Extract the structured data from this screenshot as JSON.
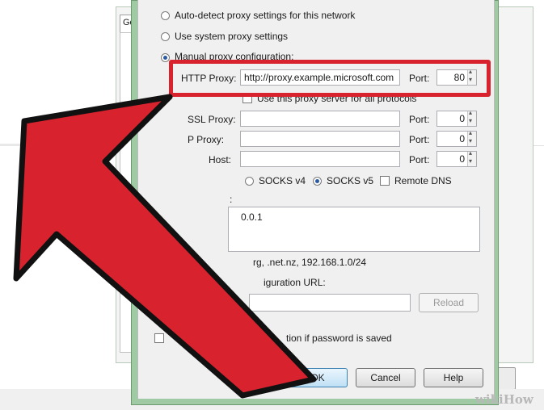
{
  "background": {
    "tab_label": "Ger"
  },
  "proxy": {
    "auto_detect": "Auto-detect proxy settings for this network",
    "system": "Use system proxy settings",
    "manual": "Manual proxy configuration:",
    "http_label": "HTTP Proxy:",
    "http_value": "http://proxy.example.microsoft.com",
    "port_label": "Port:",
    "http_port": "80",
    "same_all": "Use this proxy server for all protocols",
    "ssl_label": "SSL Proxy:",
    "ftp_label": "P Proxy:",
    "socks_label": "Host:",
    "ssl_port": "0",
    "ftp_port": "0",
    "socks_port": "0",
    "socks_v4": "SOCKS v4",
    "socks_v5": "SOCKS v5",
    "remote_dns": "Remote DNS",
    "no_proxy_label": ":",
    "no_proxy_value": "0.0.1",
    "example_text": "rg, .net.nz, 192.168.1.0/24",
    "auto_url_label": "iguration URL:",
    "reload": "Reload",
    "password_text": "tion if password is saved"
  },
  "buttons": {
    "ok": "OK",
    "cancel": "Cancel",
    "help": "Help"
  },
  "watermark": "wikiHow",
  "colors": {
    "highlight": "#d8232e",
    "arrow": "#d8232e",
    "dialog_frame": "#9fcaa3"
  }
}
